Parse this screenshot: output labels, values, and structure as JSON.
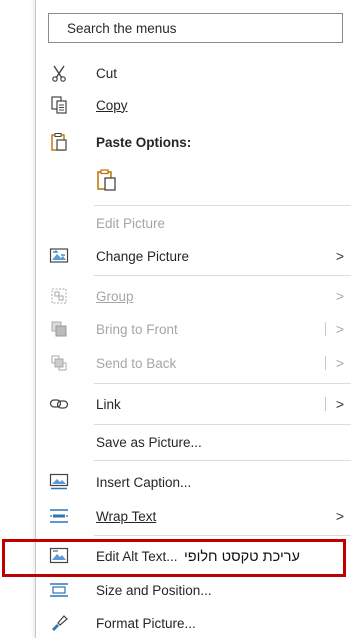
{
  "search": {
    "placeholder": "Search the menus"
  },
  "items": {
    "cut": "Cut",
    "copy": "Copy",
    "paste_options": "Paste Options:",
    "edit_picture": "Edit Picture",
    "change_picture": "Change Picture",
    "group": "Group",
    "bring_to_front": "Bring to Front",
    "send_to_back": "Send to Back",
    "link": "Link",
    "save_as_picture": "Save as Picture...",
    "insert_caption": "Insert Caption...",
    "wrap_text": "Wrap Text",
    "edit_alt_text": "Edit Alt Text...",
    "size_and_position": "Size and Position...",
    "format_picture": "Format Picture..."
  },
  "submenu_arrow": ">",
  "annotation": {
    "text": "עריכת טקסט חלופי",
    "color": "#c00000"
  },
  "colors": {
    "highlight": "#dde8f5",
    "paste_icon": "#c07000",
    "disabled_text": "#a6a6a6"
  }
}
